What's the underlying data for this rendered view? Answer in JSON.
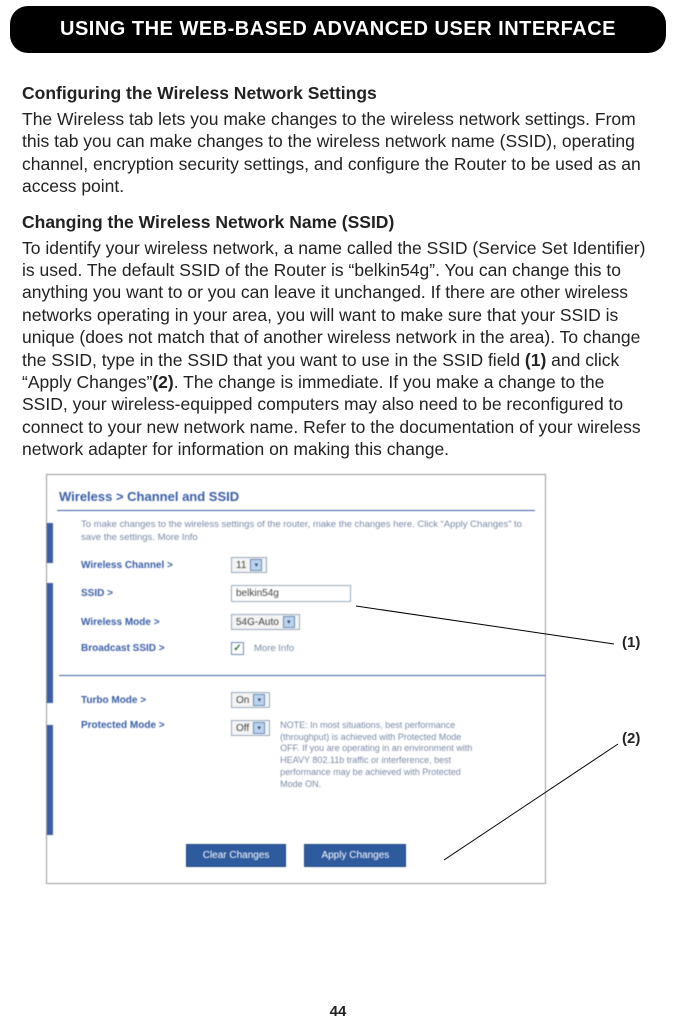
{
  "header": {
    "title": "USING THE WEB-BASED ADVANCED USER INTERFACE"
  },
  "page_number": "44",
  "sections": {
    "s1_heading": "Configuring the Wireless Network Settings",
    "s1_body": "The Wireless tab lets you make changes to the wireless network settings. From this tab you can make changes to the wireless network name (SSID), operating channel, encryption security settings, and configure the Router to be used as an access point.",
    "s2_heading": "Changing the Wireless Network Name (SSID)",
    "s2_body_a": "To identify your wireless network, a name called the SSID (Service Set Identifier) is used. The default SSID of the Router is “belkin54g”. You can change this to anything you want to or you can leave it unchanged. If there are other wireless networks operating in your area, you will want to make sure that your SSID is unique (does not match that of another wireless network in the area). To change the SSID, type in the SSID that you want to use in the SSID field ",
    "s2_bold1": "(1)",
    "s2_body_b": " and click “Apply Changes”",
    "s2_bold2": "(2)",
    "s2_body_c": ". The change is immediate. If you make a change to the SSID, your wireless-equipped computers may also need to be reconfigured to connect to your new network name. Refer to the documentation of your wireless network adapter for information on making this change."
  },
  "callouts": {
    "one": "(1)",
    "two": "(2)"
  },
  "router": {
    "breadcrumb": "Wireless > Channel and SSID",
    "help": "To make changes to the wireless settings of the router, make the changes here. Click “Apply Changes” to save the settings. More Info",
    "labels": {
      "channel": "Wireless Channel >",
      "ssid": "SSID >",
      "mode": "Wireless Mode >",
      "broadcast": "Broadcast SSID >",
      "turbo": "Turbo Mode >",
      "protected": "Protected Mode >"
    },
    "values": {
      "channel": "11",
      "ssid": "belkin54g",
      "mode": "54G-Auto",
      "turbo": "On",
      "protected": "Off",
      "more_info": "More Info"
    },
    "note": "NOTE: In most situations, best performance (throughput) is achieved with Protected Mode OFF. If you are operating in an environment with HEAVY 802.11b traffic or interference, best performance may be achieved with Protected Mode ON.",
    "buttons": {
      "clear": "Clear Changes",
      "apply": "Apply Changes"
    }
  }
}
